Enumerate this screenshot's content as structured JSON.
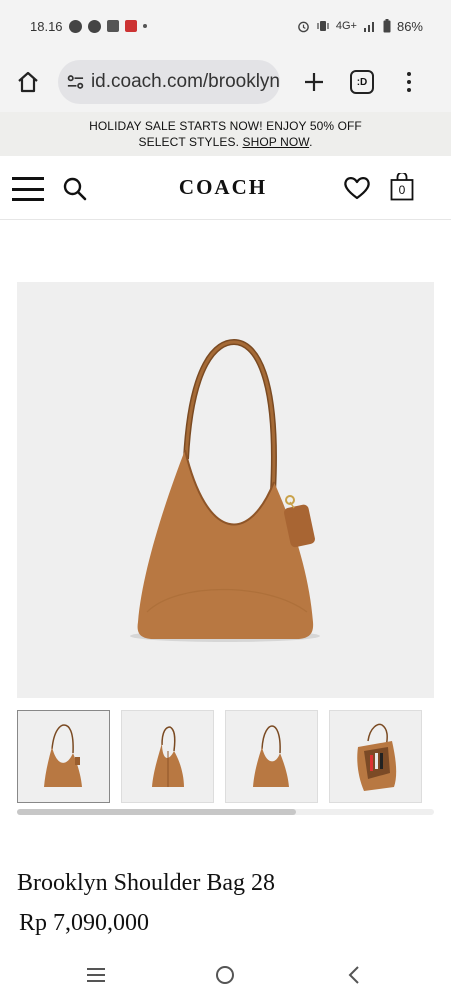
{
  "status_bar": {
    "time": "18.16",
    "network": "4G+",
    "battery": "86%"
  },
  "browser": {
    "url": "id.coach.com/brooklyn",
    "tab_count": ":D"
  },
  "promo": {
    "line1": "HOLIDAY SALE STARTS NOW! ENJOY 50% OFF",
    "line2_prefix": "SELECT STYLES. ",
    "link": "SHOP NOW",
    "line2_suffix": "."
  },
  "header": {
    "logo": "COACH",
    "cart_count": "0"
  },
  "gallery": {
    "thumbnail_count": 4,
    "active_index": 0,
    "scroll_fraction": 0.67
  },
  "product": {
    "title": "Brooklyn Shoulder Bag 28",
    "price": "Rp 7,090,000"
  },
  "colors": {
    "leather": "#b87842",
    "leather_dark": "#8e5528",
    "background": "#efefef"
  }
}
